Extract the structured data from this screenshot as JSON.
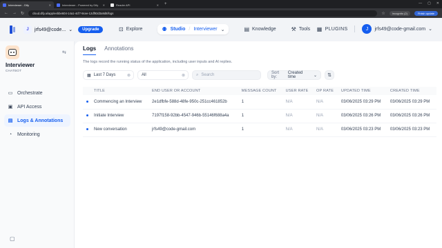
{
  "browser": {
    "tabs": [
      {
        "label": "Interviewer - Dify",
        "active": true
      },
      {
        "label": "Interviewer - Powered by Dify",
        "active": false
      },
      {
        "label": "Reader API",
        "active": false
      }
    ],
    "new_tab": "+",
    "url": "cloud.dify.ai/app/eebbe604-14a1-4cf7-9cee-12df93d3a9d8/logs",
    "incognito_label": "Incognito (2)",
    "finish_update": "Finish update"
  },
  "nav": {
    "workspace": "jrfs49@code...",
    "workspace_initial": "J",
    "upgrade": "Upgrade",
    "explore": "Explore",
    "studio": "Studio",
    "app_name": "Interviewer",
    "knowledge": "Knowledge",
    "tools": "Tools",
    "plugins": "PLUGINS",
    "user_initial": "J",
    "user_email": "jrfs49@code-gmail.com"
  },
  "sidebar": {
    "app_title": "Interviewer",
    "app_type": "CHATBOT",
    "items": [
      {
        "label": "Orchestrate",
        "icon": "terminal-icon",
        "active": false
      },
      {
        "label": "API Access",
        "icon": "api-icon",
        "active": false
      },
      {
        "label": "Logs & Annotations",
        "icon": "document-icon",
        "active": true
      },
      {
        "label": "Monitoring",
        "icon": "monitor-icon",
        "active": false
      }
    ]
  },
  "main": {
    "tabs": [
      {
        "label": "Logs",
        "active": true
      },
      {
        "label": "Annotations",
        "active": false
      }
    ],
    "description": "The logs record the running status of the application, including user inputs and AI replies.",
    "filters": {
      "date": "Last 7 Days",
      "status": "All",
      "search_placeholder": "Search",
      "sort_label": "Sort by:",
      "sort_value": "Created time"
    },
    "table": {
      "headers": [
        "TITLE",
        "END USER OR ACCOUNT",
        "MESSAGE COUNT",
        "USER RATE",
        "OP RATE",
        "UPDATED TIME",
        "CREATED TIME"
      ],
      "rows": [
        [
          "Commencing an Interview",
          "2e1dfbfe-588d-48fe-950c-251cc461852b",
          "1",
          "N/A",
          "N/A",
          "03/06/2025 03:29 PM",
          "03/06/2025 03:29 PM"
        ],
        [
          "Initiate Interview",
          "7197f158-92bb-4547-946b-55146f688a4a",
          "1",
          "N/A",
          "N/A",
          "03/06/2025 03:26 PM",
          "03/06/2025 03:26 PM"
        ],
        [
          "New conversation",
          "jrfs49@code-gmail.com",
          "1",
          "N/A",
          "N/A",
          "03/06/2025 03:23 PM",
          "03/06/2025 03:23 PM"
        ]
      ]
    }
  }
}
